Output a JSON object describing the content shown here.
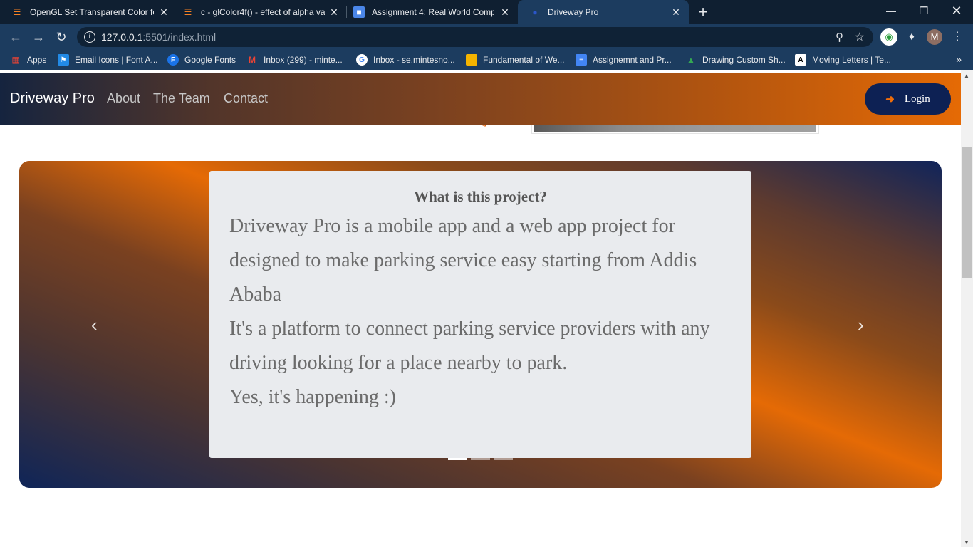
{
  "browser": {
    "tabs": [
      {
        "title": "OpenGL Set Transparent Color fo",
        "icon": "stackoverflow-icon",
        "active": false
      },
      {
        "title": "c - glColor4f() - effect of alpha va",
        "icon": "stackoverflow-icon",
        "active": false
      },
      {
        "title": "Assignment 4: Real World Compl",
        "icon": "classroom-icon",
        "active": false
      },
      {
        "title": "Driveway Pro",
        "icon": "driveway-icon",
        "active": true
      }
    ],
    "url_host": "127.0.0.1",
    "url_path": ":5501/index.html",
    "profile_initial": "M",
    "bookmarks": [
      {
        "label": "Apps",
        "icon": "apps-grid-icon"
      },
      {
        "label": "Email Icons | Font A...",
        "icon": "flag-icon"
      },
      {
        "label": "Google Fonts",
        "icon": "google-fonts-icon"
      },
      {
        "label": "Inbox (299) - minte...",
        "icon": "gmail-icon"
      },
      {
        "label": "Inbox - se.mintesno...",
        "icon": "google-icon"
      },
      {
        "label": "Fundamental of We...",
        "icon": "folder-icon"
      },
      {
        "label": "Assignemnt and Pr...",
        "icon": "docs-icon"
      },
      {
        "label": "Drawing Custom Sh...",
        "icon": "chart-icon"
      },
      {
        "label": "Moving Letters | Te...",
        "icon": "letters-icon"
      }
    ]
  },
  "navbar": {
    "brand": "Driveway Pro",
    "links": [
      "About",
      "The Team",
      "Contact"
    ],
    "login_label": "Login"
  },
  "carousel": {
    "title": "What is this project?",
    "lines": [
      "Driveway Pro is a mobile app and a web app project for",
      "designed to make parking service easy starting from Addis",
      "Ababa",
      "It's a platform to connect parking service providers with any",
      "driving looking for a place nearby to park.",
      "Yes, it's happening :)"
    ],
    "slide_count": 3,
    "active_slide": 1
  },
  "colors": {
    "navbar_gradient_start": "#15243f",
    "navbar_gradient_end": "#e56a05",
    "login_bg": "#0d2154",
    "login_icon": "#f06d0a",
    "card_bg": "#e9ebee"
  }
}
